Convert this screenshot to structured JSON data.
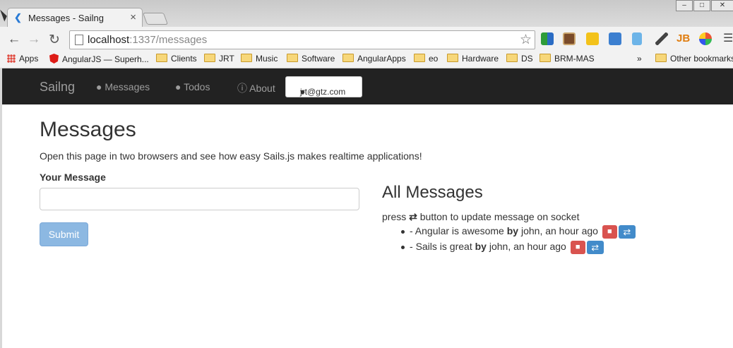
{
  "browser": {
    "tab_title": "Messages - Sailng",
    "tab_close": "×",
    "url_host": "localhost",
    "url_path": ":1337/messages",
    "window_controls": [
      "–",
      "□",
      "✕"
    ],
    "bookmarks": [
      {
        "label": "Apps",
        "icon": "apps-grid-icon"
      },
      {
        "label": "AngularJS — Superh...",
        "icon": "angular-icon"
      },
      {
        "label": "Clients",
        "icon": "folder-icon"
      },
      {
        "label": "JRT",
        "icon": "folder-icon"
      },
      {
        "label": "Music",
        "icon": "folder-icon"
      },
      {
        "label": "Software",
        "icon": "folder-icon"
      },
      {
        "label": "AngularApps",
        "icon": "folder-icon"
      },
      {
        "label": "eo",
        "icon": "folder-icon"
      },
      {
        "label": "Hardware",
        "icon": "folder-icon"
      },
      {
        "label": "DS",
        "icon": "folder-icon"
      },
      {
        "label": "BRM-MAS",
        "icon": "folder-icon"
      }
    ],
    "overflow": "»",
    "other_bookmarks": "Other bookmarks"
  },
  "navbar": {
    "brand": "Sailng",
    "links": [
      {
        "label": "Messages",
        "icon": "comments-icon"
      },
      {
        "label": "Todos",
        "icon": "comments-icon"
      },
      {
        "label": "About",
        "icon": "info-circle-icon"
      }
    ],
    "user_email": "jrt@gtz.com"
  },
  "page": {
    "title": "Messages",
    "intro": "Open this page in two browsers and see how easy Sails.js makes realtime applications!",
    "form_label": "Your Message",
    "input_value": "",
    "submit_label": "Submit",
    "all_title": "All Messages",
    "hint_before": "press",
    "hint_after": "button to update message on socket",
    "messages": [
      {
        "text": "Angular is awesome",
        "by": "by",
        "author": "john",
        "time": "an hour ago"
      },
      {
        "text": "Sails is great",
        "by": "by",
        "author": "john",
        "time": "an hour ago"
      }
    ]
  },
  "colors": {
    "navbar_bg": "#222222",
    "danger": "#d9534f",
    "primary": "#428bca",
    "submit_disabled": "#8cb8e2"
  }
}
